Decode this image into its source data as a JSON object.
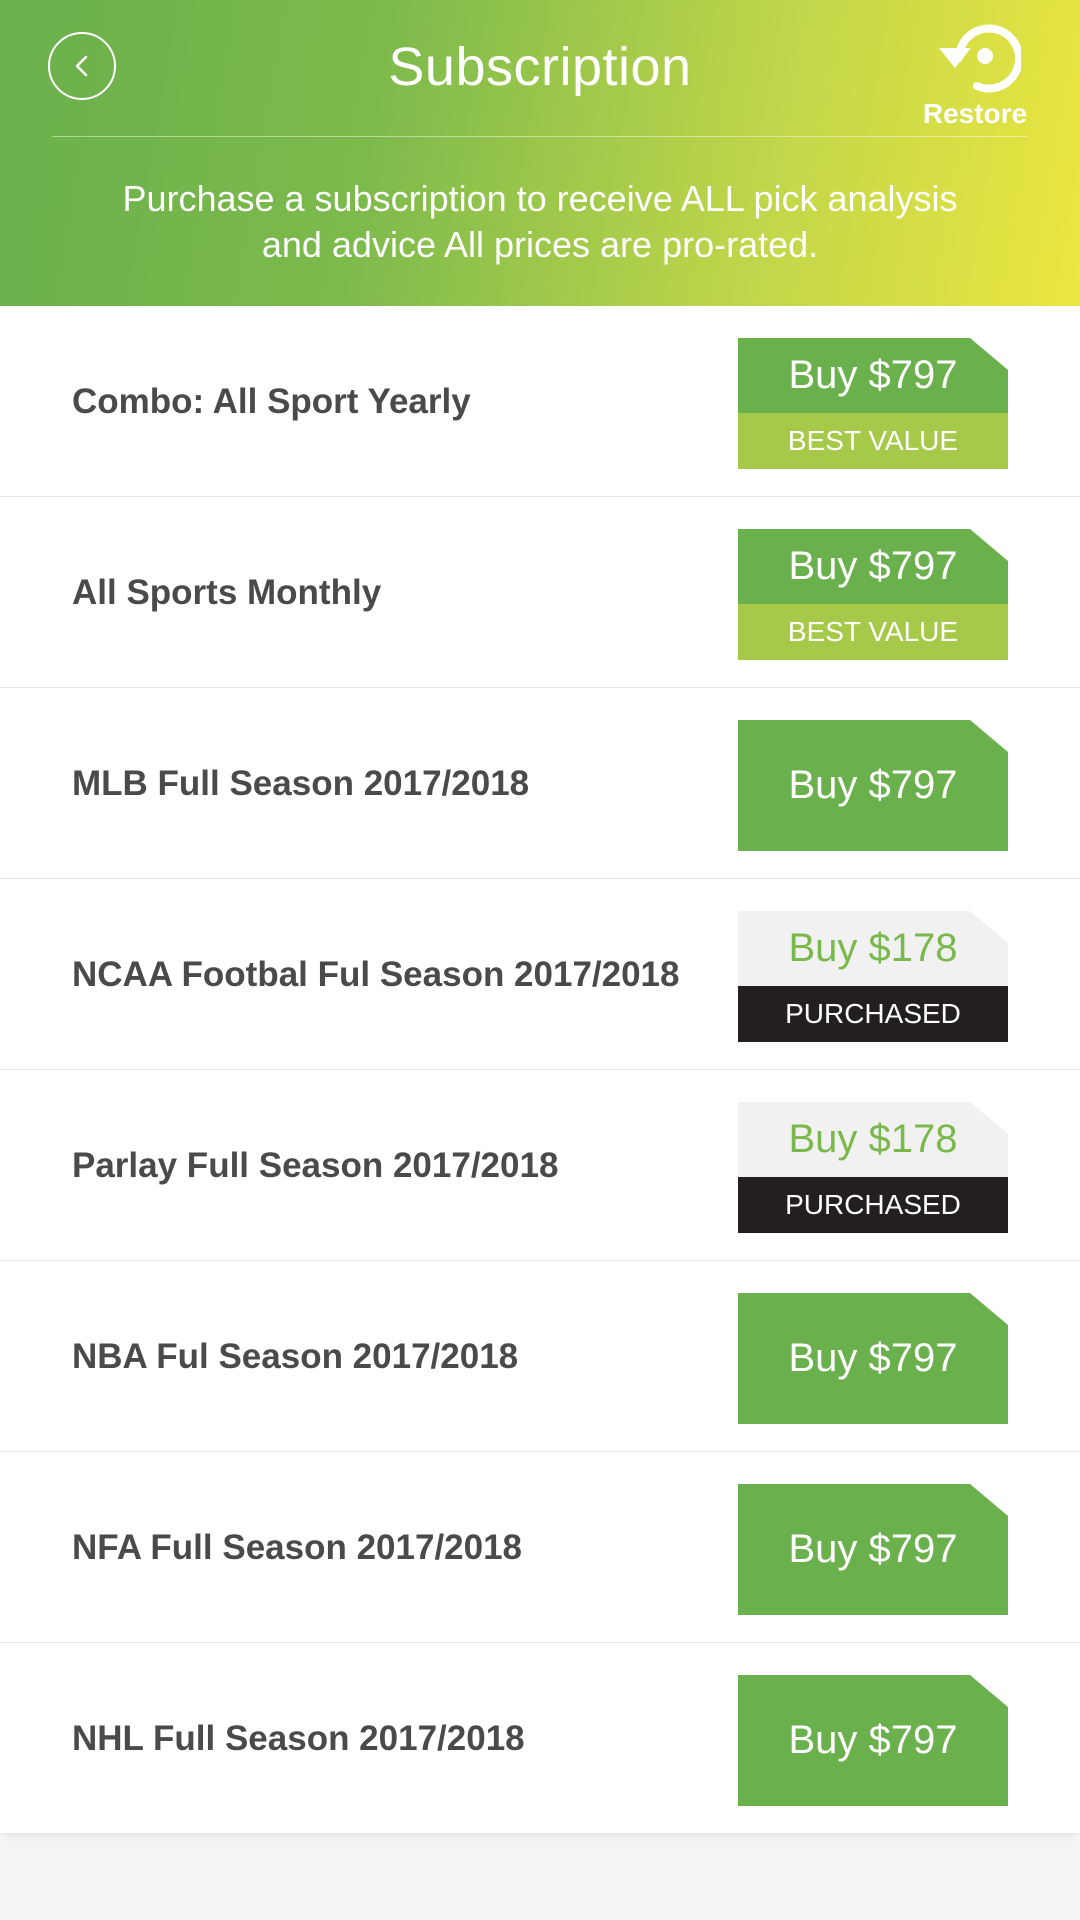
{
  "header": {
    "title": "Subscription",
    "restore_label": "Restore",
    "subtitle": "Purchase a subscription to receive  ALL pick analysis\nand advice All prices are pro-rated."
  },
  "subscriptions": [
    {
      "name": "Combo: All Sport Yearly",
      "price": "Buy $797",
      "badge": "BEST VALUE",
      "status": "best"
    },
    {
      "name": "All Sports Monthly",
      "price": "Buy $797",
      "badge": "BEST VALUE",
      "status": "best"
    },
    {
      "name": "MLB Full Season 2017/2018",
      "price": "Buy $797",
      "badge": "",
      "status": "available"
    },
    {
      "name": "NCAA Footbal Ful Season 2017/2018",
      "price": "Buy $178",
      "badge": "PURCHASED",
      "status": "purchased"
    },
    {
      "name": "Parlay Full Season 2017/2018",
      "price": "Buy $178",
      "badge": "PURCHASED",
      "status": "purchased"
    },
    {
      "name": "NBA Ful Season 2017/2018",
      "price": "Buy $797",
      "badge": "",
      "status": "available"
    },
    {
      "name": "NFA Full Season 2017/2018",
      "price": "Buy $797",
      "badge": "",
      "status": "available"
    },
    {
      "name": "NHL Full Season 2017/2018",
      "price": "Buy $797",
      "badge": "",
      "status": "available"
    }
  ],
  "colors": {
    "accent_green": "#6ab04c",
    "best_value": "#a6c94a",
    "purchased_badge": "#231f20",
    "gradient_end": "#ece640"
  },
  "icons": {
    "back": "chevron-left-icon",
    "restore": "restore-icon"
  }
}
